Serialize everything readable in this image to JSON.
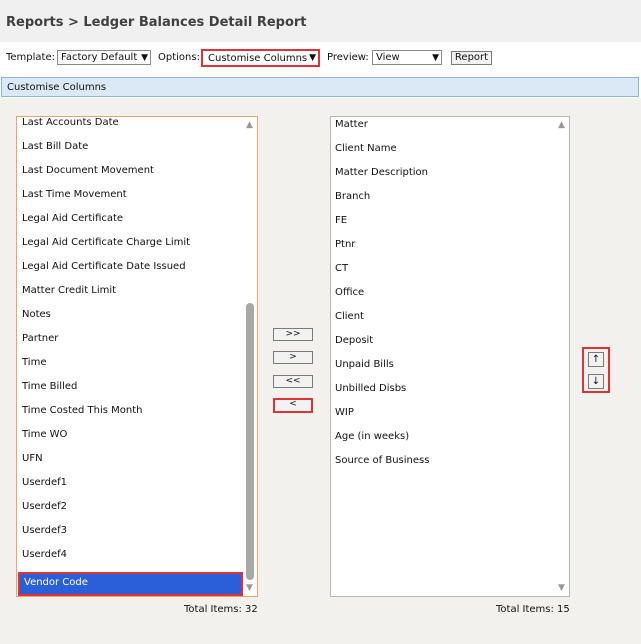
{
  "header": {
    "title": "Reports > Ledger Balances Detail Report"
  },
  "toolbar": {
    "template_label": "Template:",
    "template_value": "Factory Default",
    "options_label": "Options:",
    "options_value": "Customise Columns",
    "preview_label": "Preview:",
    "preview_value": "View",
    "report_button": "Report"
  },
  "section": {
    "title": "Customise Columns"
  },
  "available": {
    "items": [
      "Last Accounts Date",
      "Last Bill Date",
      "Last Document Movement",
      "Last Time Movement",
      "Legal Aid Certificate",
      "Legal Aid Certificate Charge Limit",
      "Legal Aid Certificate Date Issued",
      "Matter Credit Limit",
      "Notes",
      "Partner",
      "Time",
      "Time Billed",
      "Time Costed This Month",
      "Time WO",
      "UFN",
      "Userdef1",
      "Userdef2",
      "Userdef3",
      "Userdef4"
    ],
    "selected_item": "Vendor Code",
    "total": "Total Items: 32"
  },
  "selected": {
    "items": [
      "Matter",
      "Client Name",
      "Matter Description",
      "Branch",
      "FE",
      "Ptnr",
      "CT",
      "Office",
      "Client",
      "Deposit",
      "Unpaid Bills",
      "Unbilled Disbs",
      "WIP",
      "Age (in weeks)",
      "Source of Business"
    ],
    "total": "Total Items: 15"
  },
  "move_buttons": {
    "add_all": ">>",
    "add": ">",
    "remove_all": "<<",
    "remove": "<"
  },
  "order_buttons": {
    "up": "↑",
    "down": "↓"
  },
  "colors": {
    "selection": "#2b5fd9",
    "highlight_border": "#e03333",
    "section_bar": "#dbe8f5"
  }
}
